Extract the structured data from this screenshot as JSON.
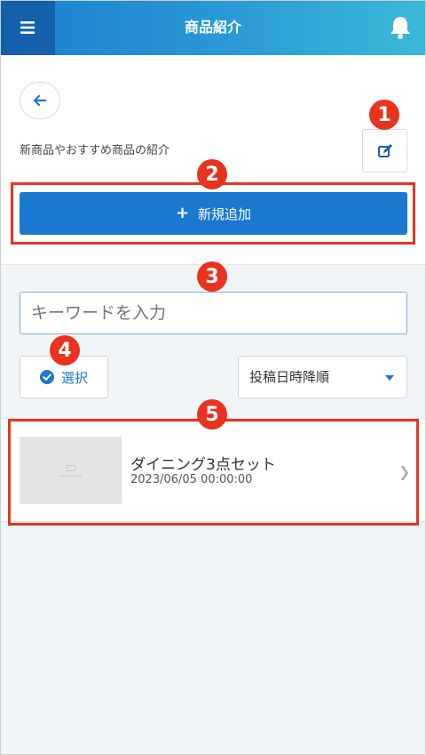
{
  "header": {
    "title": "商品紹介",
    "menu_icon": "hamburger-menu-icon",
    "notification_icon": "bell-icon"
  },
  "top": {
    "back_icon": "arrow-left-icon",
    "description": "新商品やおすすめ商品の紹介",
    "edit_icon": "edit-icon",
    "add_button_label": "新規追加"
  },
  "search": {
    "placeholder": "キーワードを入力"
  },
  "controls": {
    "select_label": "選択",
    "sort_selected": "投稿日時降順"
  },
  "items": [
    {
      "title": "ダイニング3点セット",
      "date": "2023/06/05 00:00:00"
    }
  ],
  "annotations": {
    "badges": [
      "1",
      "2",
      "3",
      "4",
      "5"
    ],
    "color": "#e8331f"
  },
  "colors": {
    "accent": "#1b78d0",
    "header_dark": "#1560ab"
  }
}
